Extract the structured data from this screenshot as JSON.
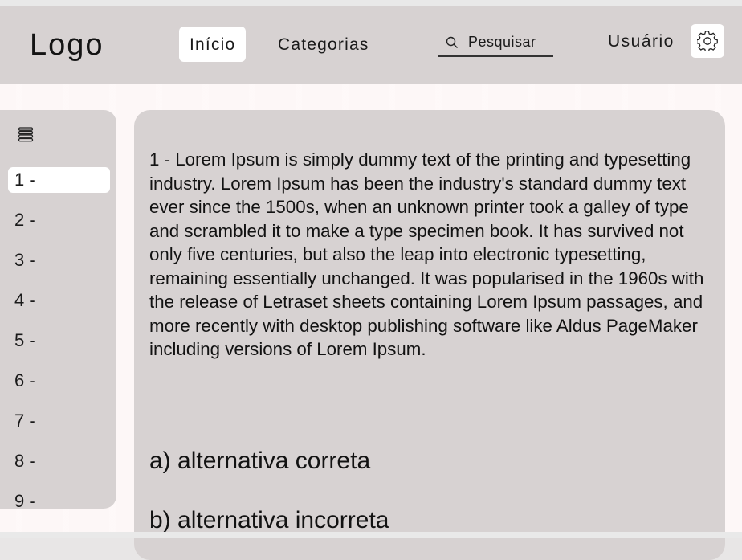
{
  "header": {
    "logo": "Logo",
    "nav": [
      {
        "label": "Início",
        "active": true
      },
      {
        "label": "Categorias",
        "active": false
      }
    ],
    "search": {
      "placeholder": "Pesquisar",
      "icon": "search-icon"
    },
    "user_label": "Usuário",
    "settings_icon": "gear-icon"
  },
  "sidebar": {
    "menu_icon": "list-icon",
    "items": [
      {
        "label": "1 -",
        "active": true
      },
      {
        "label": "2 -"
      },
      {
        "label": "3 -"
      },
      {
        "label": "4 -"
      },
      {
        "label": "5 -"
      },
      {
        "label": "6 -"
      },
      {
        "label": "7 -"
      },
      {
        "label": "8 -"
      },
      {
        "label": "9 -"
      }
    ]
  },
  "main": {
    "question_text": "1 - Lorem Ipsum is simply dummy text of the printing and typesetting industry. Lorem Ipsum has been the industry's standard dummy text ever since the 1500s, when an unknown printer took a galley of type and scrambled it to make a type specimen book. It has survived not only five centuries, but also the leap into electronic typesetting, remaining essentially unchanged. It was popularised in the 1960s with the release of Letraset sheets containing Lorem Ipsum passages, and more recently with desktop publishing software like Aldus PageMaker including versions of Lorem Ipsum.",
    "options": [
      "a) alternativa correta",
      "b) alternativa incorreta"
    ]
  },
  "colors": {
    "panel": "#d7d2d2",
    "background": "#fdf7f7",
    "active": "#ffffff",
    "text": "#121212"
  }
}
